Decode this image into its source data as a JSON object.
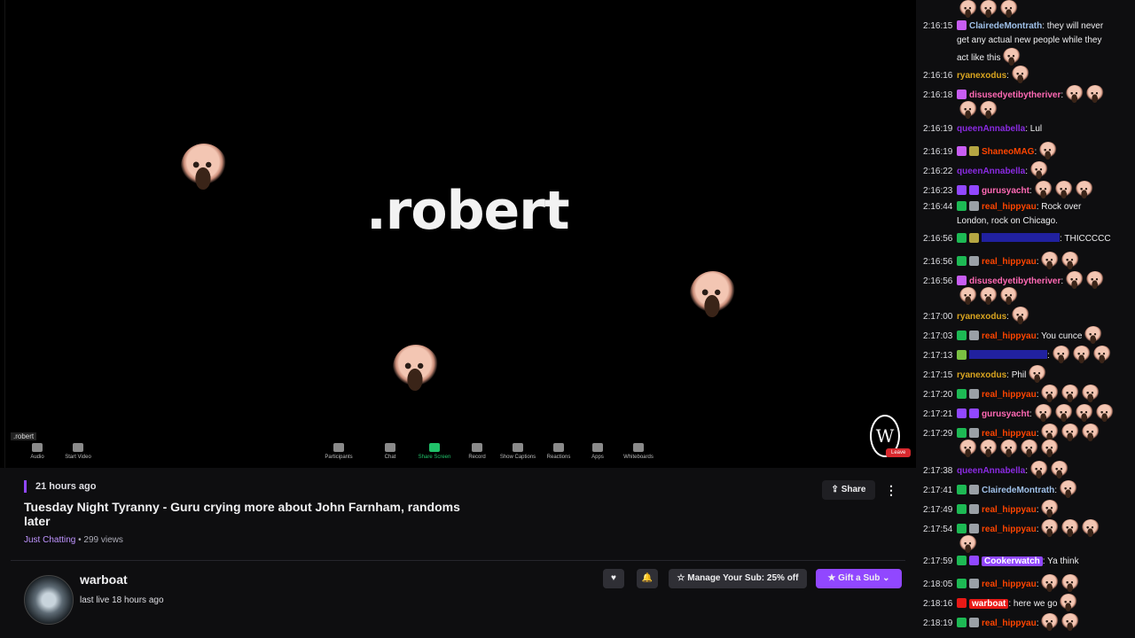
{
  "video": {
    "participant_name": ".robert",
    "participant_label": ".robert",
    "toolbar": [
      {
        "label": "Audio",
        "name": "audio"
      },
      {
        "label": "Start Video",
        "name": "start-video"
      },
      {
        "label": "Participants",
        "name": "participants"
      },
      {
        "label": "Chat",
        "name": "chat"
      },
      {
        "label": "Share Screen",
        "name": "share-screen"
      },
      {
        "label": "Record",
        "name": "record"
      },
      {
        "label": "Show Captions",
        "name": "show-captions"
      },
      {
        "label": "Reactions",
        "name": "reactions"
      },
      {
        "label": "Apps",
        "name": "apps"
      },
      {
        "label": "Whiteboards",
        "name": "whiteboards"
      }
    ],
    "watermark_letter": "W",
    "leave_label": "Leave"
  },
  "info": {
    "time_ago": "21 hours ago",
    "title": "Tuesday Night Tyranny - Guru crying more about John Farnham, randoms later",
    "category": "Just Chatting",
    "views": "• 299 views",
    "share_label": "Share",
    "more_label": "⋮",
    "channel_name": "warboat",
    "last_live": "last live 18 hours ago",
    "heart_label": "♥",
    "bell_label": "🔔",
    "manage_sub_label": "☆ Manage Your Sub: 25% off",
    "gift_sub_label": "★ Gift a Sub ⌄"
  },
  "chat": [
    {
      "time": "",
      "user": "",
      "color": "",
      "text": "",
      "emotes": 3,
      "badges": []
    },
    {
      "time": "2:16:15",
      "user": "ClairedeMontrath",
      "color": "#9fc0e8",
      "text": " they will never",
      "cont": "get any actual new people while they",
      "cont2": "act like this",
      "emotes": 0,
      "cont2_emotes": 1,
      "badges": [
        "#c85df3"
      ]
    },
    {
      "time": "2:16:16",
      "user": "ryanexodus",
      "color": "#daa520",
      "text": "",
      "emotes": 1,
      "badges": []
    },
    {
      "time": "2:16:18",
      "user": "disusedyetibytheriver",
      "color": "#ff69b4",
      "text": "",
      "emotes": 2,
      "cont_emotes": 2,
      "badges": [
        "#c85df3"
      ]
    },
    {
      "time": "2:16:19",
      "user": "queenAnnabella",
      "color": "#8a2be2",
      "text": " Lul",
      "emotes": 0,
      "badges": []
    },
    {
      "time": "2:16:19",
      "user": "ShaneoMAG",
      "color": "#ff4500",
      "text": "",
      "emotes": 1,
      "badges": [
        "#c85df3",
        "#b5a642"
      ]
    },
    {
      "time": "2:16:22",
      "user": "queenAnnabella",
      "color": "#8a2be2",
      "text": "",
      "emotes": 1,
      "badges": []
    },
    {
      "time": "2:16:23",
      "user": "gurusyacht",
      "color": "#ff69b4",
      "text": "",
      "emotes": 3,
      "badges": [
        "#9147ff",
        "#9147ff"
      ]
    },
    {
      "time": "2:16:44",
      "user": "real_hippyau",
      "color": "#ff4500",
      "text": " Rock over",
      "cont": "London, rock on Chicago.",
      "emotes": 0,
      "badges": [
        "#1db954",
        "#9aa0a6"
      ]
    },
    {
      "time": "2:16:56",
      "user": "",
      "color": "#2e2eff",
      "text": " THICCCCC",
      "emotes": 0,
      "badges": [
        "#1db954",
        "#b5a642"
      ],
      "hidden_name": true
    },
    {
      "time": "2:16:56",
      "user": "real_hippyau",
      "color": "#ff4500",
      "text": "",
      "emotes": 2,
      "badges": [
        "#1db954",
        "#9aa0a6"
      ]
    },
    {
      "time": "2:16:56",
      "user": "disusedyetibytheriver",
      "color": "#ff69b4",
      "text": "",
      "emotes": 2,
      "cont_emotes": 3,
      "badges": [
        "#c85df3"
      ]
    },
    {
      "time": "2:17:00",
      "user": "ryanexodus",
      "color": "#daa520",
      "text": "",
      "emotes": 1,
      "badges": []
    },
    {
      "time": "2:17:03",
      "user": "real_hippyau",
      "color": "#ff4500",
      "text": " You cunce",
      "emotes": 1,
      "badges": [
        "#1db954",
        "#9aa0a6"
      ]
    },
    {
      "time": "2:17:13",
      "user": "",
      "color": "#2e2eff",
      "text": "",
      "emotes": 3,
      "badges": [
        "#7ac142"
      ],
      "hidden_name": true
    },
    {
      "time": "2:17:15",
      "user": "ryanexodus",
      "color": "#daa520",
      "text": " Phil",
      "emotes": 1,
      "badges": []
    },
    {
      "time": "2:17:20",
      "user": "real_hippyau",
      "color": "#ff4500",
      "text": "",
      "emotes": 3,
      "badges": [
        "#1db954",
        "#9aa0a6"
      ]
    },
    {
      "time": "2:17:21",
      "user": "gurusyacht",
      "color": "#ff69b4",
      "text": "",
      "emotes": 4,
      "badges": [
        "#9147ff",
        "#9147ff"
      ]
    },
    {
      "time": "2:17:29",
      "user": "real_hippyau",
      "color": "#ff4500",
      "text": "",
      "emotes": 3,
      "cont_emotes": 5,
      "badges": [
        "#1db954",
        "#9aa0a6"
      ]
    },
    {
      "time": "2:17:38",
      "user": "queenAnnabella",
      "color": "#8a2be2",
      "text": "",
      "emotes": 2,
      "badges": []
    },
    {
      "time": "2:17:41",
      "user": "ClairedeMontrath",
      "color": "#9fc0e8",
      "text": "",
      "emotes": 1,
      "badges": [
        "#1db954",
        "#9aa0a6"
      ]
    },
    {
      "time": "2:17:49",
      "user": "real_hippyau",
      "color": "#ff4500",
      "text": "",
      "emotes": 1,
      "badges": [
        "#1db954",
        "#9aa0a6"
      ]
    },
    {
      "time": "2:17:54",
      "user": "real_hippyau",
      "color": "#ff4500",
      "text": "",
      "emotes": 3,
      "cont_emotes": 1,
      "badges": [
        "#1db954",
        "#9aa0a6"
      ]
    },
    {
      "time": "2:17:59",
      "user": "Cookerwatch",
      "color": "#ffffff",
      "highlight": "#9147ff",
      "text": " Ya think",
      "emotes": 0,
      "badges": [
        "#1db954",
        "#9147ff"
      ]
    },
    {
      "time": "2:18:05",
      "user": "real_hippyau",
      "color": "#ff4500",
      "text": "",
      "emotes": 2,
      "badges": [
        "#1db954",
        "#9aa0a6"
      ]
    },
    {
      "time": "2:18:16",
      "user": "warboat",
      "color": "#ffffff",
      "highlight": "#e91916",
      "text": " here we go",
      "emotes": 1,
      "badges": [
        "#e91916"
      ]
    },
    {
      "time": "2:18:19",
      "user": "real_hippyau",
      "color": "#ff4500",
      "text": "",
      "emotes": 2,
      "badges": [
        "#1db954",
        "#9aa0a6"
      ]
    }
  ]
}
